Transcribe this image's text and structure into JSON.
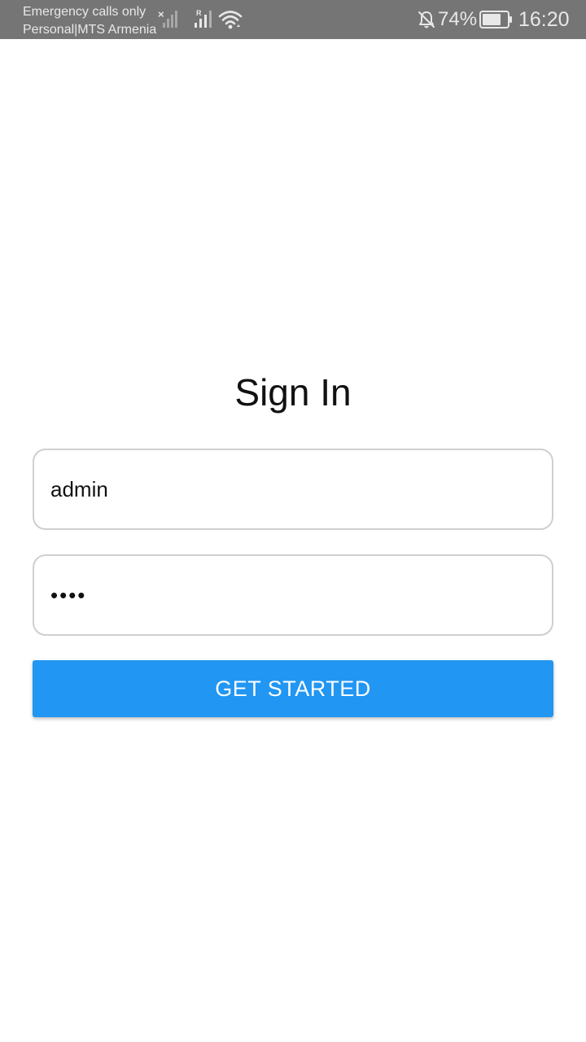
{
  "status_bar": {
    "carrier_line1": "Emergency calls only",
    "carrier_line2": "Personal|MTS Armenia",
    "battery_percent": "74%",
    "time": "16:20",
    "icons": [
      "signal-no-service-icon",
      "signal-roaming-icon",
      "wifi-icon",
      "bell-off-icon",
      "battery-icon"
    ],
    "roaming_mark": "R",
    "no_service_mark": "×",
    "background_color": "#757575"
  },
  "signin": {
    "title": "Sign In",
    "username_value": "admin",
    "password_value": "1234",
    "button_label": "GET STARTED",
    "button_color": "#2196f3"
  }
}
